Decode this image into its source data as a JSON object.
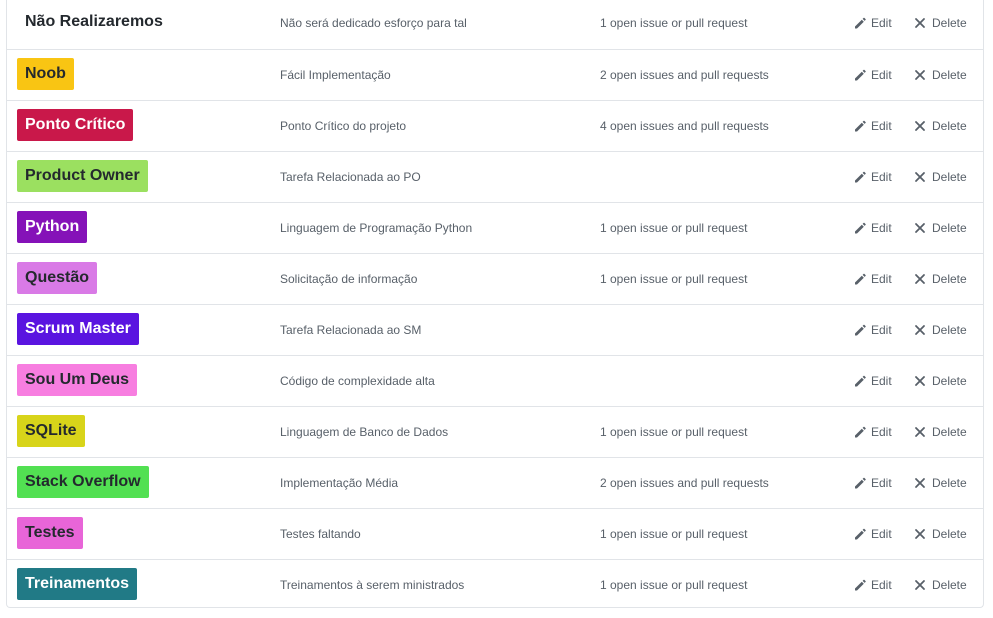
{
  "actions": {
    "edit_label": "Edit",
    "delete_label": "Delete"
  },
  "icons": {
    "edit": "pencil-icon",
    "delete": "x-icon"
  },
  "labels": [
    {
      "name": "Não Realizaremos",
      "description": "Não será dedicado esforço para tal",
      "issues": "1 open issue or pull request",
      "color": "#ffffff",
      "text_color": "#24292e"
    },
    {
      "name": "Noob",
      "description": "Fácil Implementação",
      "issues": "2 open issues and pull requests",
      "color": "#f9c513",
      "text_color": "#24292e"
    },
    {
      "name": "Ponto Crítico",
      "description": "Ponto Crítico do projeto",
      "issues": "4 open issues and pull requests",
      "color": "#c9184a",
      "text_color": "#ffffff"
    },
    {
      "name": "Product Owner",
      "description": "Tarefa Relacionada ao PO",
      "issues": "",
      "color": "#9be060",
      "text_color": "#24292e"
    },
    {
      "name": "Python",
      "description": "Linguagem de Programação Python",
      "issues": "1 open issue or pull request",
      "color": "#8512b8",
      "text_color": "#ffffff"
    },
    {
      "name": "Questão",
      "description": "Solicitação de informação",
      "issues": "1 open issue or pull request",
      "color": "#d97ae6",
      "text_color": "#24292e"
    },
    {
      "name": "Scrum Master",
      "description": "Tarefa Relacionada ao SM",
      "issues": "",
      "color": "#5a14e0",
      "text_color": "#ffffff"
    },
    {
      "name": "Sou Um Deus",
      "description": "Código de complexidade alta",
      "issues": "",
      "color": "#f77ee0",
      "text_color": "#24292e"
    },
    {
      "name": "SQLite",
      "description": "Linguagem de Banco de Dados",
      "issues": "1 open issue or pull request",
      "color": "#d8d41a",
      "text_color": "#24292e"
    },
    {
      "name": "Stack Overflow",
      "description": "Implementação Média",
      "issues": "2 open issues and pull requests",
      "color": "#52e052",
      "text_color": "#24292e"
    },
    {
      "name": "Testes",
      "description": "Testes faltando",
      "issues": "1 open issue or pull request",
      "color": "#e865d8",
      "text_color": "#24292e"
    },
    {
      "name": "Treinamentos",
      "description": "Treinamentos à serem ministrados",
      "issues": "1 open issue or pull request",
      "color": "#217a86",
      "text_color": "#ffffff"
    }
  ]
}
